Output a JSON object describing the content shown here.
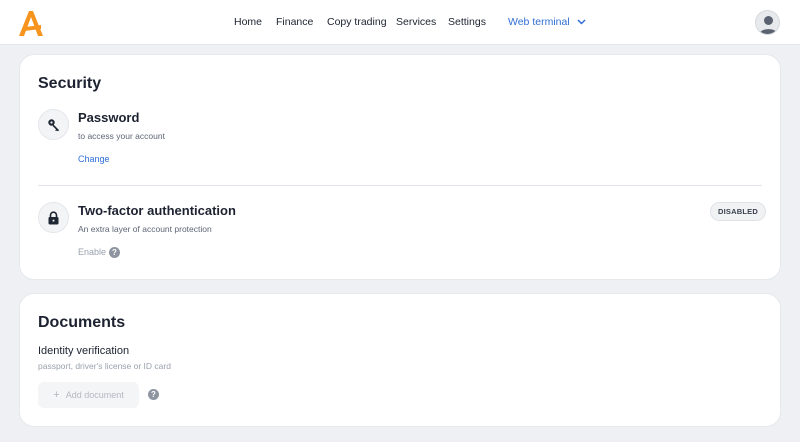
{
  "header": {
    "logo_icon": "brand-a-logo-icon",
    "nav": [
      {
        "label": "Home"
      },
      {
        "label": "Finance"
      },
      {
        "label": "Copy trading"
      },
      {
        "label": "Services"
      },
      {
        "label": "Settings"
      },
      {
        "label": "Web terminal",
        "has_dropdown": true
      }
    ],
    "avatar_icon": "user-avatar-icon"
  },
  "security": {
    "title": "Security",
    "password": {
      "icon": "key-icon",
      "title": "Password",
      "subtitle": "to access your account",
      "action": "Change"
    },
    "two_factor": {
      "icon": "lock-icon",
      "title": "Two-factor authentication",
      "subtitle": "An extra layer of account protection",
      "action": "Enable",
      "status": "DISABLED"
    }
  },
  "documents": {
    "title": "Documents",
    "identity_label": "Identity verification",
    "identity_sub": "passport, driver's license or ID card",
    "add_button": "Add document"
  },
  "colors": {
    "brand": "#f7941d",
    "accent": "#2f6fd6",
    "background": "#eef0f3"
  }
}
